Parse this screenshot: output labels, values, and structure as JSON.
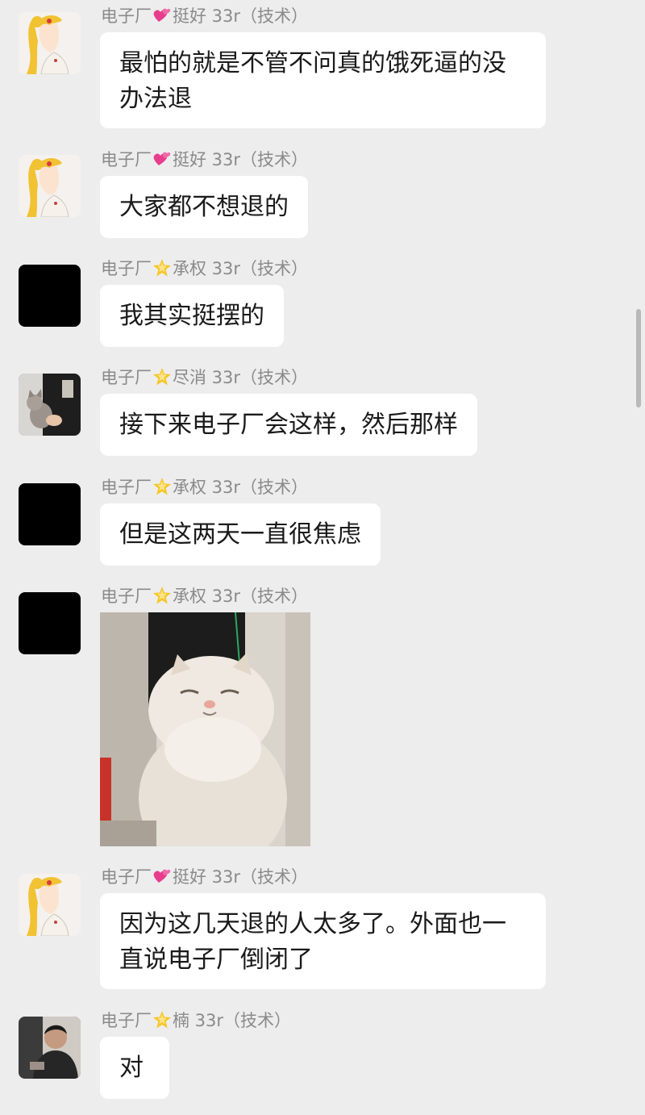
{
  "colors": {
    "background": "#ededed",
    "bubble": "#ffffff",
    "sender_text": "#8a8a8a",
    "message_text": "#1a1a1a"
  },
  "messages": [
    {
      "sender": {
        "group": "电子厂",
        "badge": "pink-hearts-icon",
        "name": "挺好 33r（技术）"
      },
      "text_lines": [
        "最怕的就是不管不问真的饿死逼的没",
        "办法退"
      ],
      "avatar": "sailor-moon-avatar"
    },
    {
      "sender": {
        "group": "电子厂",
        "badge": "pink-hearts-icon",
        "name": "挺好 33r（技术）"
      },
      "text": "大家都不想退的",
      "avatar": "sailor-moon-avatar"
    },
    {
      "sender": {
        "group": "电子厂",
        "badge": "gold-star-icon",
        "name": "承权 33r（技术）"
      },
      "text": "我其实挺摆的",
      "avatar": "black-avatar"
    },
    {
      "sender": {
        "group": "电子厂",
        "badge": "gold-star-icon",
        "name": "尽消 33r（技术）"
      },
      "text": "接下来电子厂会这样，然后那样",
      "avatar": "cat-avatar"
    },
    {
      "sender": {
        "group": "电子厂",
        "badge": "gold-star-icon",
        "name": "承权 33r（技术）"
      },
      "text": "但是这两天一直很焦虑",
      "avatar": "black-avatar"
    },
    {
      "sender": {
        "group": "电子厂",
        "badge": "gold-star-icon",
        "name": "承权 33r（技术）"
      },
      "image": "squinting-cat-photo",
      "avatar": "black-avatar"
    },
    {
      "sender": {
        "group": "电子厂",
        "badge": "pink-hearts-icon",
        "name": "挺好 33r（技术）"
      },
      "text_lines": [
        "因为这几天退的人太多了。外面也一",
        "直说电子厂倒闭了"
      ],
      "avatar": "sailor-moon-avatar"
    },
    {
      "sender": {
        "group": "电子厂",
        "badge": "gold-star-icon",
        "name": "楠 33r（技术）"
      },
      "text": "对",
      "avatar": "man-avatar"
    }
  ]
}
